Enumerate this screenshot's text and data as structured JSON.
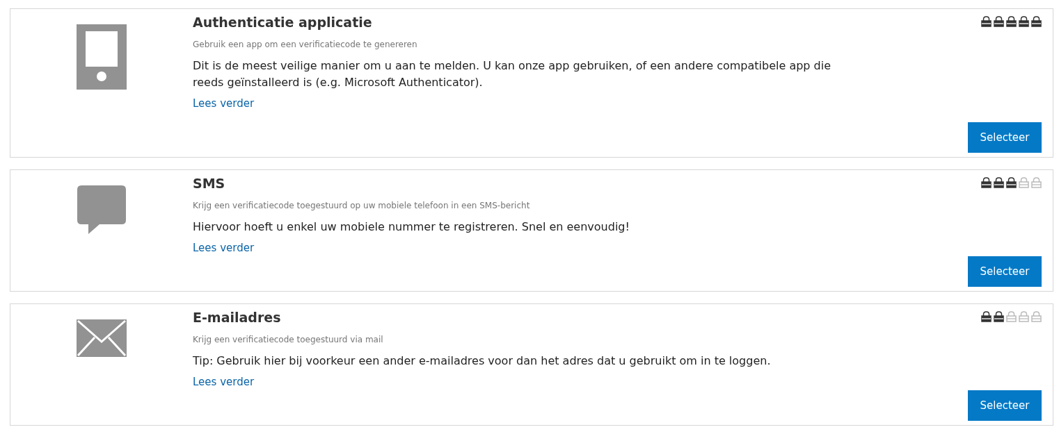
{
  "methods": [
    {
      "kind": "phone",
      "title": "Authenticatie applicatie",
      "subtitle": "Gebruik een app om een verificatiecode te genereren",
      "description": "Dit is de meest veilige manier om u aan te melden. U kan onze app gebruiken, of een andere compatibele app die reeds geïnstalleerd is (e.g. Microsoft Authenticator).",
      "link": "Lees verder",
      "button": "Selecteer",
      "stars": 5
    },
    {
      "kind": "chat",
      "title": "SMS",
      "subtitle": "Krijg een verificatiecode toegestuurd op uw mobiele telefoon in een SMS-bericht",
      "description": "Hiervoor hoeft u enkel uw mobiele nummer te registreren. Snel en eenvoudig!",
      "link": "Lees verder",
      "button": "Selecteer",
      "stars": 3
    },
    {
      "kind": "mail",
      "title": "E-mailadres",
      "subtitle": "Krijg een verificatiecode toegestuurd via mail",
      "description": "Tip: Gebruik hier bij voorkeur een ander e-mailadres voor dan het adres dat u gebruikt om in te loggen.",
      "link": "Lees verder",
      "button": "Selecteer",
      "stars": 2
    }
  ]
}
